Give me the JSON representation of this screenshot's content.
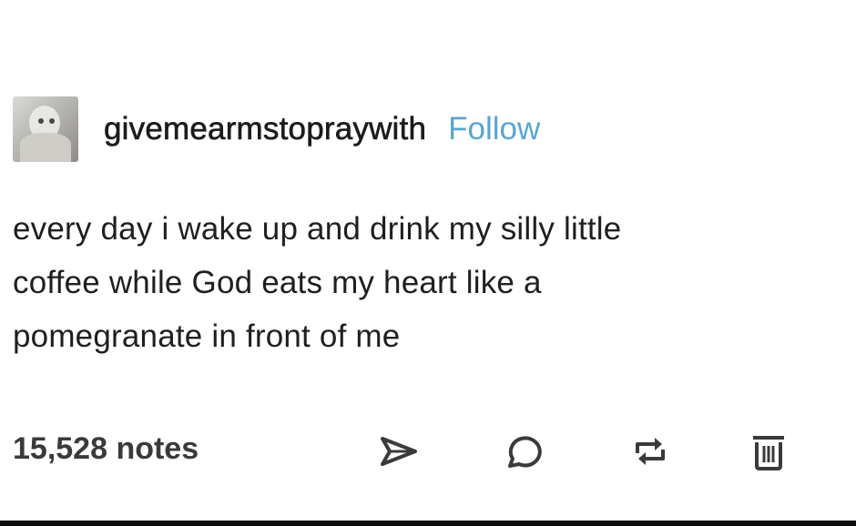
{
  "post": {
    "username": "givemearmstopraywith",
    "follow_label": "Follow",
    "text_lines": [
      "every day i wake up and drink my silly little",
      "coffee while God eats my heart like a",
      "pomegranate in front of me"
    ],
    "notes": "15,528 notes"
  },
  "icons": {
    "avatar": "avatar-photo",
    "share": "paper-plane-icon",
    "reply": "speech-bubble-icon",
    "reblog": "reblog-arrows-icon",
    "delete": "trash-icon"
  },
  "colors": {
    "follow": "#58a6d0",
    "text": "#1f1f1f",
    "icons": "#3a3a3a"
  }
}
